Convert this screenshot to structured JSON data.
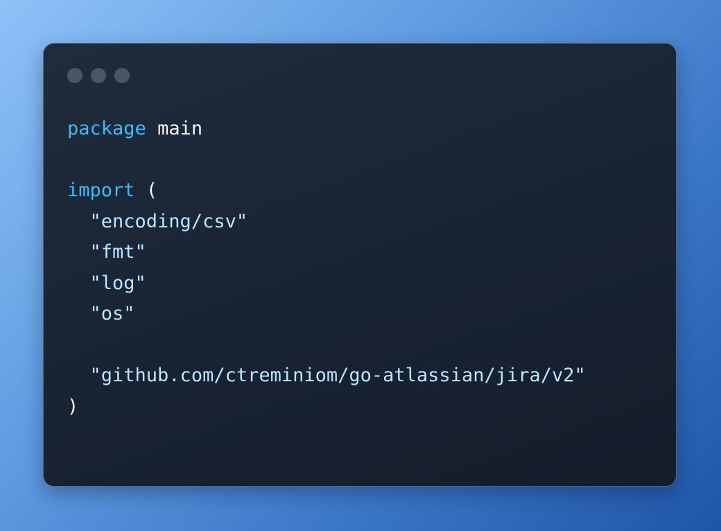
{
  "window": {
    "dots": [
      "dot-1",
      "dot-2",
      "dot-3"
    ]
  },
  "code": {
    "line1": {
      "keyword": "package",
      "name": "main"
    },
    "line3": {
      "keyword": "import",
      "paren": "("
    },
    "imports": [
      "\"encoding/csv\"",
      "\"fmt\"",
      "\"log\"",
      "\"os\""
    ],
    "external_import": "\"github.com/ctreminiom/go-atlassian/jira/v2\"",
    "close_paren": ")"
  },
  "colors": {
    "keyword": "#38bdf8",
    "string": "#bae6fd",
    "text": "#f3f4f6",
    "window_bg": "#1b2636",
    "dot": "#4b5563"
  }
}
